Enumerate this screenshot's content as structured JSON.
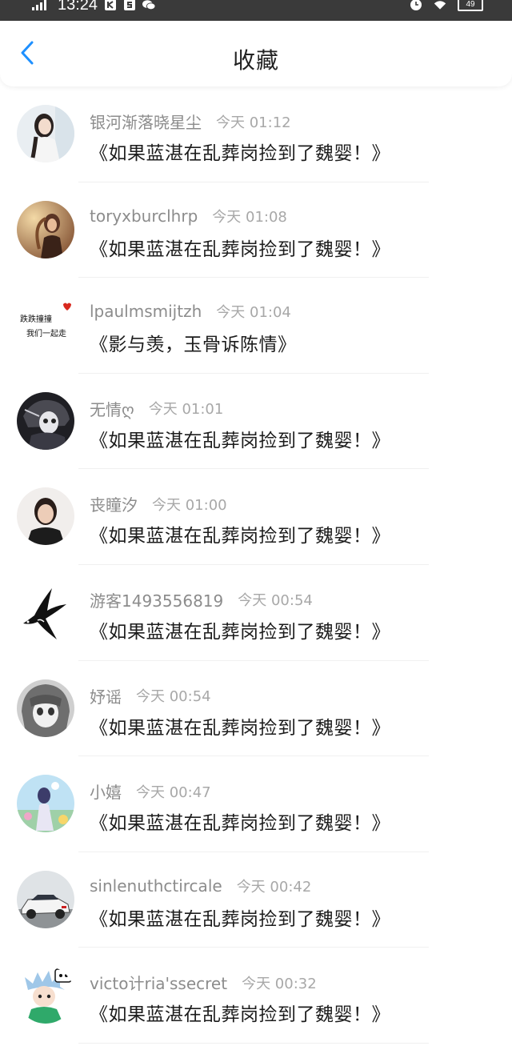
{
  "status_bar": {
    "time": "13:24",
    "battery": "49",
    "icons": [
      "signal-icon",
      "app-k-icon",
      "app-s-icon",
      "wechat-icon",
      "alarm-icon",
      "wifi-icon",
      "battery-icon"
    ]
  },
  "header": {
    "title": "收藏",
    "back_icon": "chevron-left-icon",
    "accent_color": "#1e90ff"
  },
  "items": [
    {
      "username": "银河渐落晓星尘",
      "time": "今天 01:12",
      "title": "《如果蓝湛在乱葬岗捡到了魏婴！》",
      "avatar": "photo-girl-white"
    },
    {
      "username": "toryxburclhrp",
      "time": "今天 01:08",
      "title": "《如果蓝湛在乱葬岗捡到了魏婴！》",
      "avatar": "photo-girl-sunset"
    },
    {
      "username": "lpaulmsmijtzh",
      "time": "今天 01:04",
      "title": "《影与羡，玉骨诉陈情》",
      "avatar": "handwritten-text",
      "avatar_text_1": "跌跌撞撞",
      "avatar_text_2": "我们一起走"
    },
    {
      "username": "无情ღ",
      "time": "今天 01:01",
      "title": "《如果蓝湛在乱葬岗捡到了魏婴！》",
      "avatar": "anime-boy-dark"
    },
    {
      "username": "丧瞳汐",
      "time": "今天 01:00",
      "title": "《如果蓝湛在乱葬岗捡到了魏婴！》",
      "avatar": "photo-woman"
    },
    {
      "username": "游客1493556819",
      "time": "今天 00:54",
      "title": "《如果蓝湛在乱葬岗捡到了魏婴！》",
      "avatar": "swallow-drawing"
    },
    {
      "username": "妤谣",
      "time": "今天 00:54",
      "title": "《如果蓝湛在乱葬岗捡到了魏婴！》",
      "avatar": "anime-girl-gray"
    },
    {
      "username": "小嬉",
      "time": "今天 00:47",
      "title": "《如果蓝湛在乱葬岗捡到了魏婴！》",
      "avatar": "anime-girl-flowers"
    },
    {
      "username": "sinlenuthctircale",
      "time": "今天 00:42",
      "title": "《如果蓝湛在乱葬岗捡到了魏婴！》",
      "avatar": "photo-car"
    },
    {
      "username": "victo计ria'ssecret",
      "time": "今天 00:32",
      "title": "《如果蓝湛在乱葬岗捡到了魏婴！》",
      "avatar": "anime-boy-green"
    }
  ]
}
